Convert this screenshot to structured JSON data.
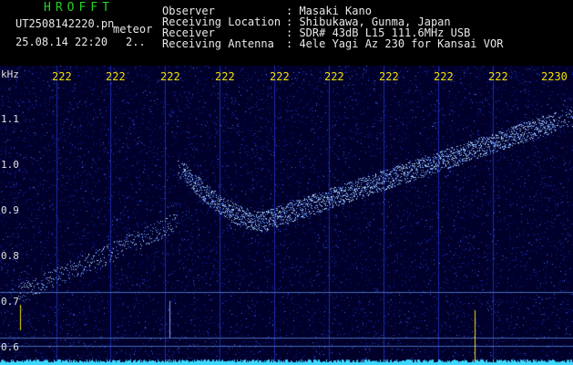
{
  "app": {
    "title": "HROFFT"
  },
  "file": {
    "name": "UT2508142220.pn",
    "tag": "meteor",
    "datetime": "25.08.14 22:20",
    "count": "2.."
  },
  "info": [
    {
      "label": "Observer",
      "value": ": Masaki Kano"
    },
    {
      "label": "Receiving Location",
      "value": ": Shibukawa, Gunma, Japan"
    },
    {
      "label": "Receiver",
      "value": ": SDR# 43dB L15 111.6MHz USB"
    },
    {
      "label": "Receiving Antenna",
      "value": ": 4ele Yagi Az 230 for Kansai VOR"
    }
  ],
  "spectrogram": {
    "unit": "kHz",
    "y_ticks": [
      "1.1",
      "1.0",
      "0.9",
      "0.8",
      "0.7",
      "0.6"
    ],
    "x_ticks": [
      "222",
      "222",
      "222",
      "222",
      "222",
      "222",
      "222",
      "222",
      "222",
      "2230"
    ],
    "colors": {
      "background": "#00002a",
      "noise": "#2238c8",
      "signal": "#bfe4ff",
      "tick": "#f2e000",
      "baseline": "#3fd8ff"
    }
  }
}
